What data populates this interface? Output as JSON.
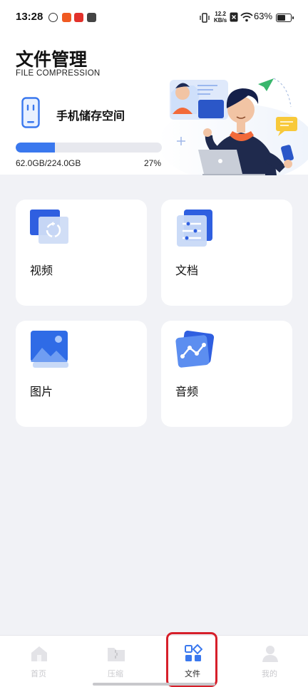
{
  "status_bar": {
    "time": "13:28",
    "network_speed_value": "12.2",
    "network_speed_unit": "KB/s",
    "battery_percent": "63%",
    "battery_level": 0.63
  },
  "header": {
    "title": "文件管理",
    "subtitle": "FILE COMPRESSION"
  },
  "storage": {
    "title": "手机储存空间",
    "used_text": "62.0GB/224.0GB",
    "percent_text": "27%",
    "fraction": 0.27,
    "progress_color": "#3a78ee"
  },
  "categories": [
    {
      "label": "视频",
      "icon": "video-icon"
    },
    {
      "label": "文档",
      "icon": "document-icon"
    },
    {
      "label": "图片",
      "icon": "image-icon"
    },
    {
      "label": "音频",
      "icon": "audio-icon"
    }
  ],
  "tabbar": {
    "tabs": [
      {
        "label": "首页",
        "icon": "home-icon",
        "active": false
      },
      {
        "label": "压缩",
        "icon": "compress-folder-icon",
        "active": false
      },
      {
        "label": "文件",
        "icon": "files-grid-icon",
        "active": true
      },
      {
        "label": "我的",
        "icon": "profile-icon",
        "active": false
      }
    ]
  },
  "colors": {
    "accent": "#3a78ee",
    "background": "#f1f2f6",
    "highlight": "#d61f2a"
  }
}
